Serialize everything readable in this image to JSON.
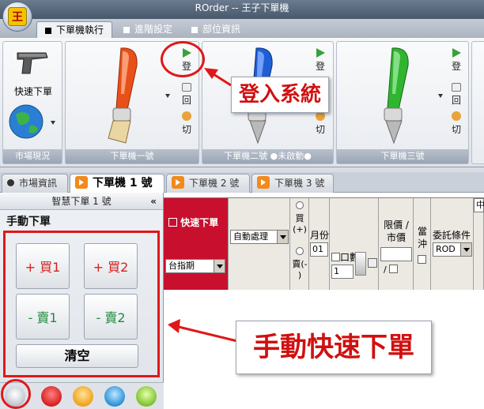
{
  "window": {
    "title": "ROrder -- 王子下單機",
    "app_button": "王"
  },
  "ribbon_tabs": [
    {
      "label": "下單機執行",
      "active": true
    },
    {
      "label": "進階設定",
      "active": false
    },
    {
      "label": "部位資訊",
      "active": false
    }
  ],
  "ribbon": {
    "market_group": {
      "label": "市場現況",
      "quick_order": "快速下單"
    },
    "groups": [
      {
        "label": "下單機一號",
        "login": "登",
        "back": "回",
        "switch": "切",
        "color": "#e8501a"
      },
      {
        "label": "下單機二號 ●未啟動●",
        "login": "登",
        "back": "回",
        "switch": "切",
        "color": "#1f5fd6"
      },
      {
        "label": "下單機三號",
        "login": "登",
        "back": "回",
        "switch": "切",
        "color": "#2fb52f"
      }
    ]
  },
  "doc_tabs": [
    {
      "label": "市場資訊",
      "active": false
    },
    {
      "label": "下單機 1 號",
      "active": true
    },
    {
      "label": "下單機 2 號",
      "active": false
    },
    {
      "label": "下單機 3 號",
      "active": false
    }
  ],
  "left_pane": {
    "header": "智慧下單 1 號",
    "collapse": "«",
    "title": "手動下單",
    "buttons": {
      "buy1": "+ 買1",
      "buy2": "+ 買2",
      "sell1": "- 賣1",
      "sell2": "- 賣2",
      "clear": "清空"
    }
  },
  "order_form": {
    "quick_order_label": "快速下單",
    "auto_mode": "自動處理",
    "instrument": "台指期",
    "buy_label": "買",
    "buy_sub": "(+)",
    "sell_label": "賣(-",
    "sell_sub": ")",
    "month_label": "月份",
    "month_value": "01",
    "qty_label": "口數",
    "qty_value": "1",
    "price_type_label": "限價 /",
    "price_type_label2": "市價",
    "slash": "/",
    "offset_label": "當",
    "offset_label2": "沖",
    "condition_label": "委託條件",
    "condition_value": "ROD",
    "cut_value": "中"
  },
  "annotations": {
    "login_callout": "登入系統",
    "manual_callout": "手動快速下單"
  },
  "colors": {
    "accent_red": "#e01818",
    "buy": "#d42020",
    "sell": "#1f8a3c"
  }
}
